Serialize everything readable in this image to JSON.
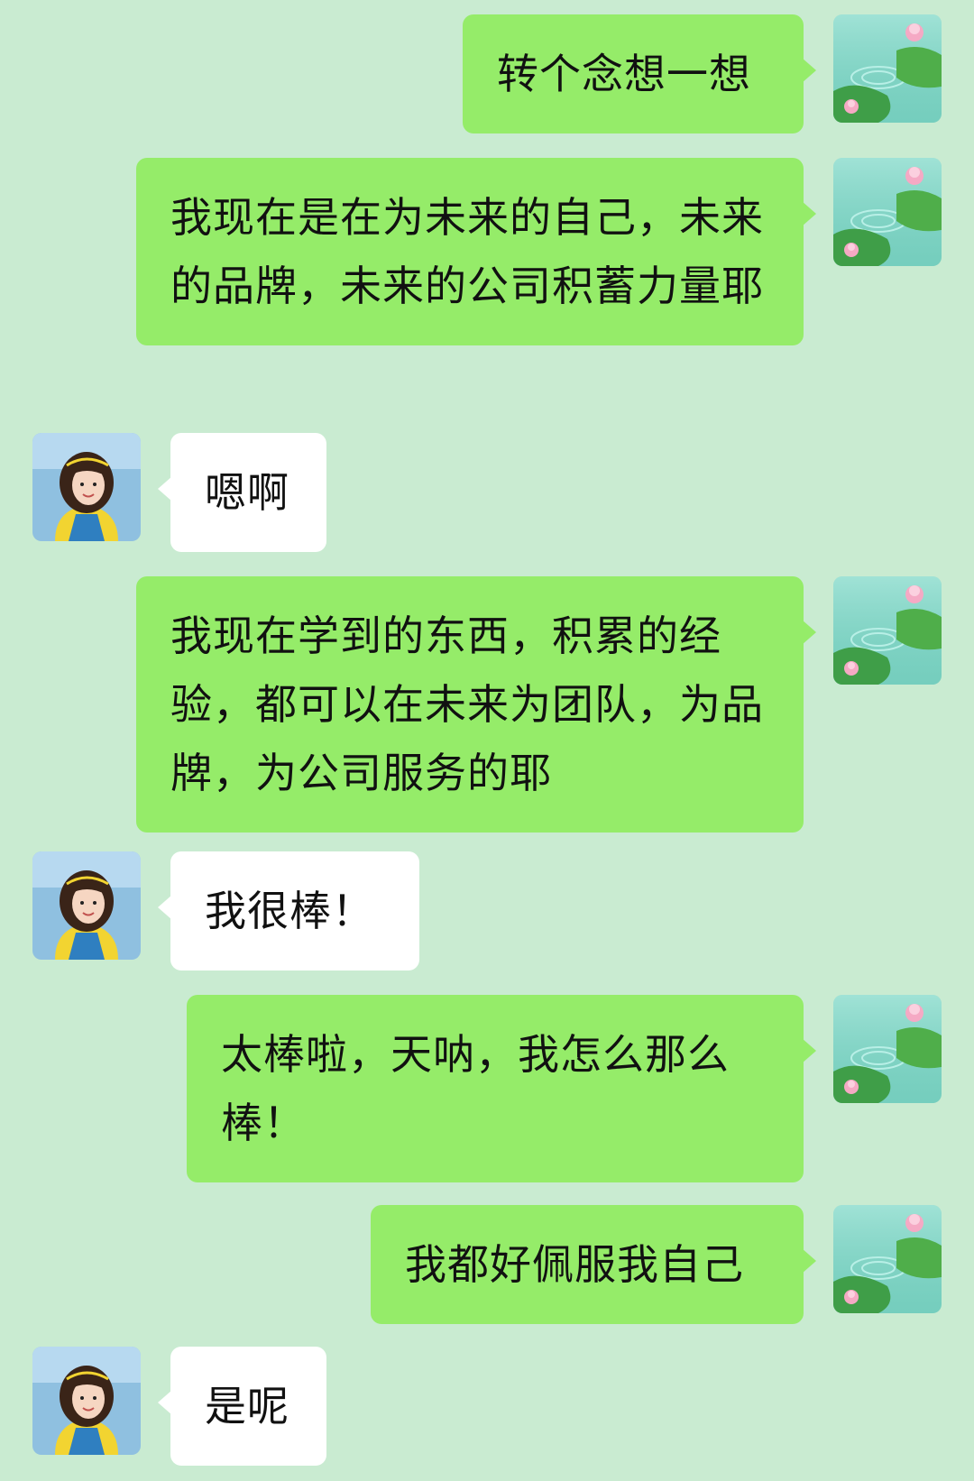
{
  "messages": [
    {
      "sender": "me",
      "text": "转个念想一想"
    },
    {
      "sender": "me",
      "text": "我现在是在为未来的自己，未来的品牌，未来的公司积蓄力量耶"
    },
    {
      "sender": "them",
      "text": "嗯啊"
    },
    {
      "sender": "me",
      "text": "我现在学到的东西，积累的经验，都可以在未来为团队，为品牌，为公司服务的耶"
    },
    {
      "sender": "them",
      "text": "我很棒！"
    },
    {
      "sender": "me",
      "text": "太棒啦，天呐，我怎么那么棒！"
    },
    {
      "sender": "me",
      "text": "我都好佩服我自己"
    },
    {
      "sender": "them",
      "text": "是呢"
    }
  ],
  "avatars": {
    "me": "lotus-pond-avatar",
    "them": "girl-portrait-avatar"
  },
  "colors": {
    "background": "#c9ebd1",
    "my_bubble": "#95ec69",
    "their_bubble": "#ffffff"
  }
}
